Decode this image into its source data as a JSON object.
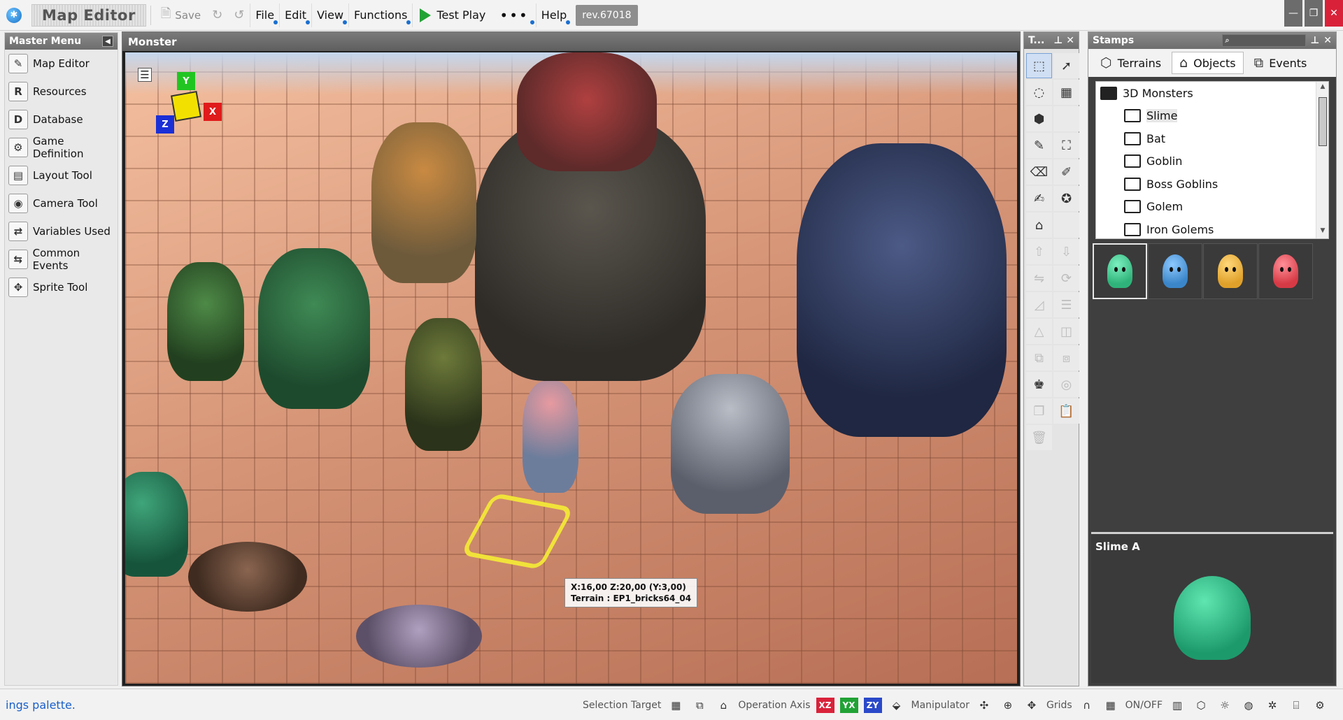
{
  "topbar": {
    "title": "Map Editor",
    "save_label": "Save",
    "menus": [
      "File",
      "Edit",
      "View",
      "Functions"
    ],
    "test_play_label": "Test Play",
    "more_label": "•••",
    "help_label": "Help",
    "revision": "rev.67018"
  },
  "master_menu": {
    "title": "Master Menu",
    "items": [
      {
        "label": "Map Editor",
        "icon": "map-editor-icon"
      },
      {
        "label": "Resources",
        "icon": "resources-icon"
      },
      {
        "label": "Database",
        "icon": "database-icon"
      },
      {
        "label": "Game Definition",
        "icon": "game-definition-icon"
      },
      {
        "label": "Layout Tool",
        "icon": "layout-tool-icon"
      },
      {
        "label": "Camera Tool",
        "icon": "camera-tool-icon"
      },
      {
        "label": "Variables Used",
        "icon": "variables-icon"
      },
      {
        "label": "Common Events",
        "icon": "common-events-icon"
      },
      {
        "label": "Sprite Tool",
        "icon": "sprite-tool-icon"
      }
    ]
  },
  "viewport": {
    "title": "Monster",
    "gizmo": {
      "y": "Y",
      "x": "X",
      "z": "Z"
    },
    "tooltip_line1": "X:16,00 Z:20,00 (Y:3,00)",
    "tooltip_line2": "Terrain : EP1_bricks64_04"
  },
  "tools_panel": {
    "title": "T..."
  },
  "stamps": {
    "title": "Stamps",
    "tabs": [
      {
        "label": "Terrains",
        "active": false
      },
      {
        "label": "Objects",
        "active": true
      },
      {
        "label": "Events",
        "active": false
      }
    ],
    "tree": {
      "root": "3D Monsters",
      "children": [
        "Slime",
        "Bat",
        "Goblin",
        "Boss Goblins",
        "Golem",
        "Iron Golems"
      ],
      "selected": "Slime"
    },
    "thumbnails": [
      {
        "color": "#2fb37a"
      },
      {
        "color": "#3b86c9"
      },
      {
        "color": "#e0a12a"
      },
      {
        "color": "#d63a45"
      }
    ],
    "preview_title": "Slime A"
  },
  "statusbar": {
    "message": "ings palette.",
    "selection_target_label": "Selection Target",
    "operation_axis_label": "Operation Axis",
    "axis_buttons": [
      "XZ",
      "YX",
      "ZY"
    ],
    "manipulator_label": "Manipulator",
    "grids_label": "Grids",
    "onoff_label": "ON/OFF"
  },
  "colors": {
    "accent": "#1a6fd0",
    "play": "#21a235",
    "close": "#d9223a",
    "axis_xz": "#d9223a",
    "axis_yx": "#21a235",
    "axis_zy": "#2a49c9",
    "selection": "#f1e23a"
  }
}
